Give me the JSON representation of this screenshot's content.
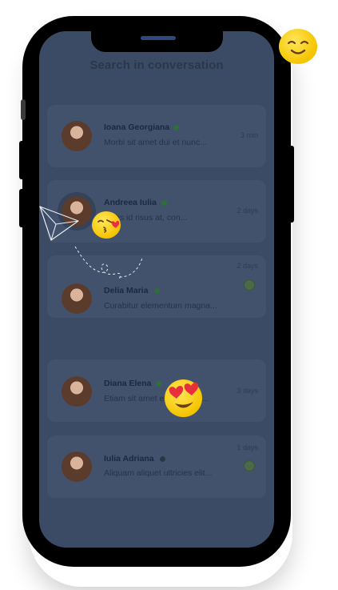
{
  "header": {
    "title": "Search in conversation"
  },
  "conversations": [
    {
      "name": "Ioana Georgiana",
      "message": "Morbi sit amet dui et nunc...",
      "time": "3 min",
      "online": true,
      "status_color": "#2f6d3a",
      "unread": false
    },
    {
      "name": "Andreea Iulia",
      "message": "...ces id risus at, con...",
      "time": "2 days",
      "online": true,
      "status_color": "#2f6d3a",
      "unread": false
    },
    {
      "name": "Delia Maria",
      "message": "Curabitur elementum magna...",
      "time": "2 days",
      "online": true,
      "status_color": "#2f6d3a",
      "unread": true
    },
    {
      "name": "Diana Elena",
      "message": "Etiam sit amet efficitur nisi...",
      "time": "3 days",
      "online": true,
      "status_color": "#2f6d3a",
      "unread": false
    },
    {
      "name": "Iulia Adriana",
      "message": "Aliquam aliquet ultricies elit...",
      "time": "1 days",
      "online": false,
      "status_color": "#2b3649",
      "unread": true
    }
  ],
  "decorations": {
    "emoji_top_right": "smiling-face-icon",
    "emoji_kiss": "kissing-face-icon",
    "emoji_love": "heart-eyes-face-icon",
    "paper_plane": "paper-plane-icon"
  },
  "colors": {
    "screen_overlay": "#3c4b65",
    "card": "#42526c",
    "online": "#2f6d3a"
  }
}
